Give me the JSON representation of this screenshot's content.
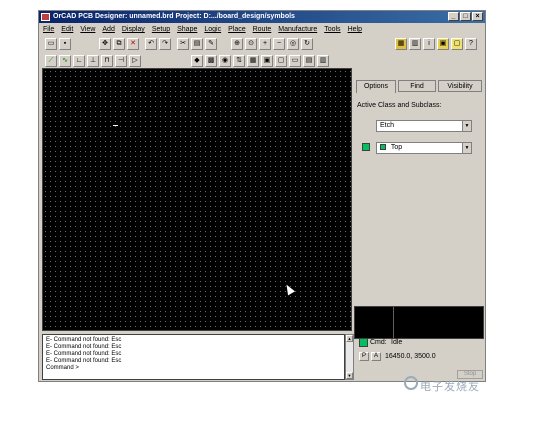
{
  "window": {
    "title": "OrCAD PCB Designer: unnamed.brd  Project: D:.../board_design/symbols",
    "controls": [
      "_",
      "□",
      "×"
    ]
  },
  "menu": [
    "File",
    "Edit",
    "View",
    "Add",
    "Display",
    "Setup",
    "Shape",
    "Logic",
    "Place",
    "Route",
    "Manufacture",
    "Tools",
    "Help"
  ],
  "panel": {
    "tabs": [
      "Options",
      "Find",
      "Visibility"
    ],
    "active_class_label": "Active Class and Subclass:",
    "class_value": "Etch",
    "subclass_value": "Top",
    "swatch_color": "#00c060"
  },
  "console": {
    "lines": [
      "E- Command not found: Esc",
      "E- Command not found: Esc",
      "E- Command not found: Esc",
      "E- Command not found: Esc",
      "Command >"
    ]
  },
  "status": {
    "cmd_label": "Cmd:",
    "cmd_state": "Idle",
    "p_label": "P",
    "a_label": "A",
    "coords": "16450.0, 3500.0",
    "stop_label": "Stop"
  },
  "watermark": "电子发烧友"
}
